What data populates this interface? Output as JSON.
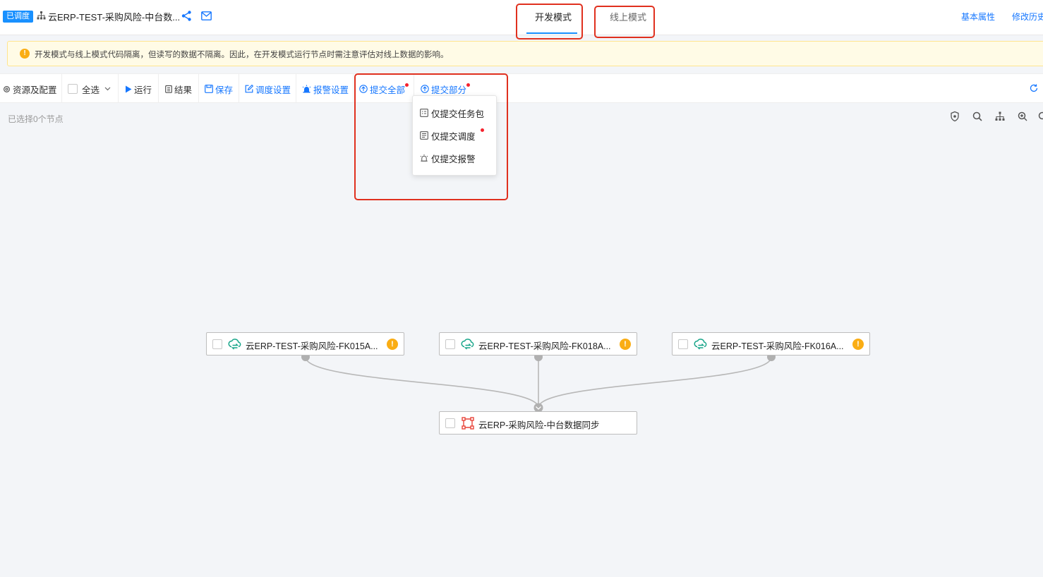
{
  "header": {
    "status_badge": "已调度",
    "title": "云ERP-TEST-采购风险-中台数...",
    "mode_tabs": {
      "dev": "开发模式",
      "online": "线上模式"
    },
    "links": {
      "basic_props": "基本属性",
      "history": "修改历史"
    }
  },
  "notice": {
    "text": "开发模式与线上模式代码隔离，但读写的数据不隔离。因此，在开发模式运行节点时需注意评估对线上数据的影响。"
  },
  "toolbar": {
    "resources": "资源及配置",
    "select_all": "全选",
    "run": "运行",
    "result": "结果",
    "save": "保存",
    "schedule_settings": "调度设置",
    "alert_settings": "报警设置",
    "submit_all": "提交全部",
    "submit_partial": "提交部分"
  },
  "dropdown": {
    "items": [
      "仅提交任务包",
      "仅提交调度",
      "仅提交报警"
    ]
  },
  "canvas": {
    "selected_info": "已选择0个节点",
    "nodes": [
      {
        "label": "云ERP-TEST-采购风险-FK015A...",
        "icon": "cloud-sync-icon",
        "warning": "!"
      },
      {
        "label": "云ERP-TEST-采购风险-FK018A...",
        "icon": "cloud-sync-icon",
        "warning": "!"
      },
      {
        "label": "云ERP-TEST-采购风险-FK016A...",
        "icon": "cloud-sync-icon",
        "warning": "!"
      },
      {
        "label": "云ERP-采购风险-中台数据同步",
        "icon": "flow-group-icon"
      }
    ]
  },
  "colors": {
    "primary": "#1677ff",
    "highlight_box": "#e0301e",
    "warning": "#faad14",
    "sync_green": "#17a589"
  }
}
